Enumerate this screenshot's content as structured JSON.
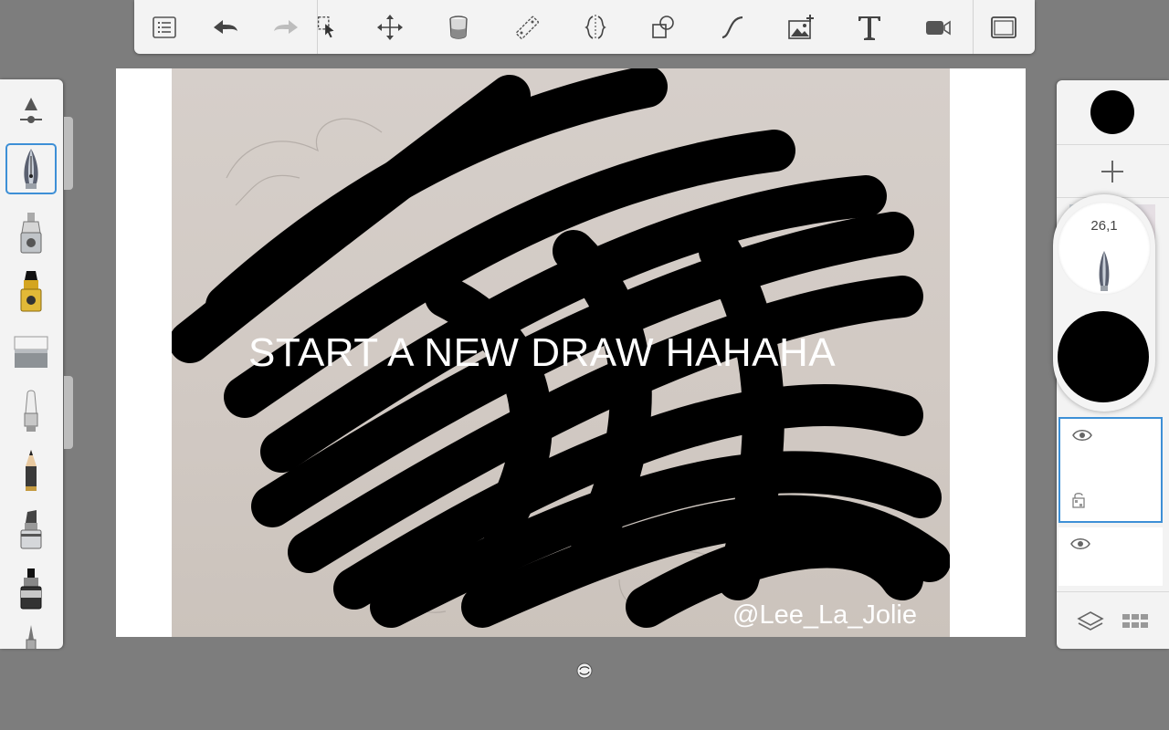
{
  "toolbar": {
    "tools": [
      {
        "name": "list-icon"
      },
      {
        "name": "undo-icon"
      },
      {
        "name": "redo-icon"
      },
      {
        "name": "selection-icon"
      },
      {
        "name": "transform-icon"
      },
      {
        "name": "fill-bucket-icon"
      },
      {
        "name": "ruler-icon"
      },
      {
        "name": "symmetry-icon"
      },
      {
        "name": "shapes-icon"
      },
      {
        "name": "stroke-icon"
      },
      {
        "name": "add-image-icon"
      },
      {
        "name": "text-icon"
      },
      {
        "name": "record-icon"
      },
      {
        "name": "fullscreen-icon"
      }
    ]
  },
  "brushes": [
    {
      "name": "size-slider-icon"
    },
    {
      "name": "fountain-pen-icon",
      "selected": true
    },
    {
      "name": "airbrush-icon"
    },
    {
      "name": "marker-icon"
    },
    {
      "name": "eraser-icon"
    },
    {
      "name": "soft-eraser-icon"
    },
    {
      "name": "pencil-icon"
    },
    {
      "name": "chisel-marker-icon"
    },
    {
      "name": "ink-pen-icon"
    },
    {
      "name": "fine-pen-icon"
    }
  ],
  "canvas": {
    "caption": "START A NEW DRAW HAHAHA",
    "watermark": "@Lee_La_Jolie"
  },
  "right_panel": {
    "brush_size_value": "26,1",
    "color": "#000000",
    "layers": [
      {
        "name": "photo-layer",
        "visible": true
      },
      {
        "name": "layer-2",
        "visible": true,
        "selected": true,
        "locked_indicator": true
      },
      {
        "name": "layer-1",
        "visible": true
      }
    ]
  },
  "colors": {
    "accent": "#3d8fd6",
    "panel": "#f3f3f3",
    "background": "#7d7d7d"
  }
}
